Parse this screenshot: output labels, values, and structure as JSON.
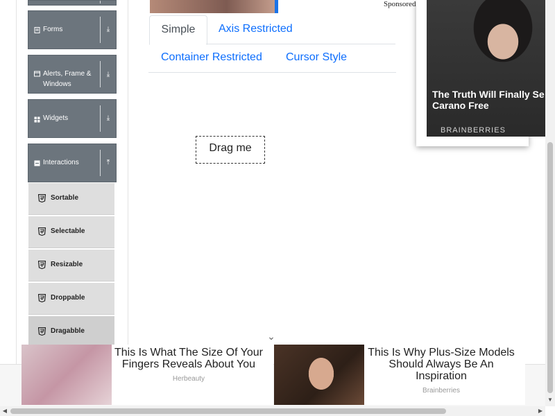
{
  "sidebar": {
    "groups": [
      {
        "label": "Forms",
        "icon": "form-icon",
        "state": "collapsed"
      },
      {
        "label": "Alerts, Frame &",
        "label2": "Windows",
        "icon": "window-icon",
        "state": "collapsed"
      },
      {
        "label": "Widgets",
        "icon": "widgets-icon",
        "state": "collapsed"
      },
      {
        "label": "Interactions",
        "icon": "interactions-icon",
        "state": "expanded"
      }
    ],
    "sub_items": [
      {
        "label": "Sortable",
        "active": false
      },
      {
        "label": "Selectable",
        "active": false
      },
      {
        "label": "Resizable",
        "active": false
      },
      {
        "label": "Droppable",
        "active": false
      },
      {
        "label": "Dragabble",
        "active": true
      }
    ]
  },
  "tabs": [
    {
      "label": "Simple",
      "active": true
    },
    {
      "label": "Axis Restricted",
      "active": false
    },
    {
      "label": "Container Restricted",
      "active": false
    },
    {
      "label": "Cursor Style",
      "active": false
    }
  ],
  "drag_box": {
    "label": "Drag me"
  },
  "top_ad": {
    "sponsored_label": "Sponsored"
  },
  "right_ad": {
    "title_line1": "The Truth Will Finally Se",
    "title_line2": "Carano Free",
    "brand": "BRAINBERRIES"
  },
  "bottom_ads": [
    {
      "title": "This Is What The Size Of Your Fingers Reveals About You",
      "source": "Herbeauty"
    },
    {
      "title": "This Is Why Plus-Size Models Should Always Be An Inspiration",
      "source": "Brainberries"
    }
  ],
  "colors": {
    "sidebar_group": "#6c757d",
    "tab_link": "#0d6efd",
    "sub_item": "#dedede"
  }
}
